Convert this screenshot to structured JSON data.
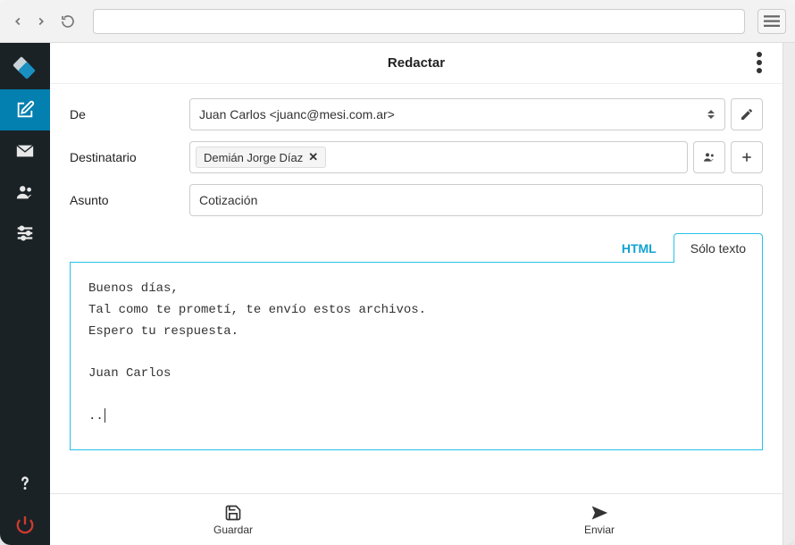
{
  "header": {
    "title": "Redactar"
  },
  "fields": {
    "from_label": "De",
    "from_value": "Juan Carlos <juanc@mesi.com.ar>",
    "to_label": "Destinatario",
    "to_chip": "Demián Jorge Díaz",
    "subject_label": "Asunto",
    "subject_value": "Cotización"
  },
  "tabs": {
    "html": "HTML",
    "text": "Sólo texto"
  },
  "body_text": "Buenos días,\nTal como te prometí, te envío estos archivos.\nEspero tu respuesta.\n\nJuan Carlos\n\n..",
  "footer": {
    "save": "Guardar",
    "send": "Enviar"
  }
}
